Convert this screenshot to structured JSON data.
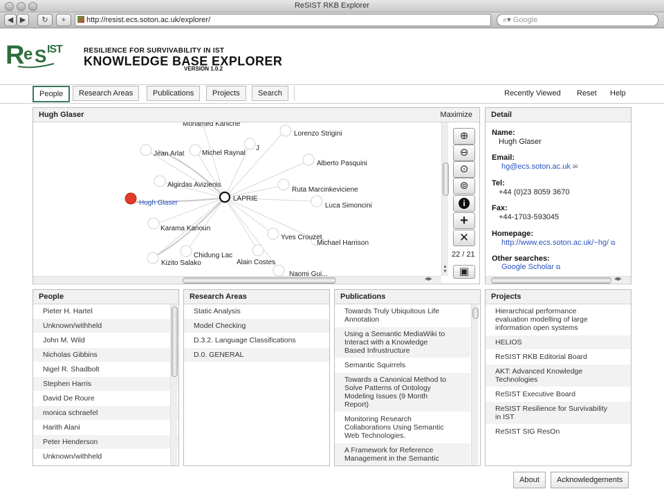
{
  "window": {
    "title": "ReSIST RKB Explorer"
  },
  "browser": {
    "url": "http://resist.ecs.soton.ac.uk/explorer/",
    "search_placeholder": "Google"
  },
  "header": {
    "logo": "ReSIST",
    "line1": "RESILIENCE FOR SURVIVABILITY IN IST",
    "line2": "KNOWLEDGE BASE EXPLORER",
    "version": "VERSION 1.0.2"
  },
  "nav": {
    "tabs": [
      "People",
      "Research Areas",
      "Publications",
      "Projects",
      "Search"
    ],
    "active": "People",
    "right": [
      "Recently Viewed",
      "Reset",
      "Help"
    ]
  },
  "graph": {
    "title": "Hugh Glaser",
    "maximize": "Maximize",
    "counter": "22 / 21",
    "center": "LAPRIE",
    "selected": "Hugh Glaser",
    "nodes": [
      "Mohamed Kaniche",
      "Lorenzo Strigini",
      "Jean Arlat",
      "Michel Raynal",
      "J",
      "Alberto Pasquini",
      "Algirdas Avizienis",
      "Ruta Marcinkeviciene",
      "Hugh Glaser",
      "Luca Simoncini",
      "Karama Kanoun",
      "Yves Crouzet",
      "Michael Harrison",
      "Chidung Lac",
      "Alain Costes",
      "Kizito Salako",
      "Naomi Gui..."
    ]
  },
  "detail": {
    "title": "Detail",
    "name_label": "Name:",
    "name": "Hugh Glaser",
    "email_label": "Email:",
    "email": "hg@ecs.soton.ac.uk",
    "tel_label": "Tel:",
    "tel": "+44 (0)23 8059 3670",
    "fax_label": "Fax:",
    "fax": "+44-1703-593045",
    "homepage_label": "Homepage:",
    "homepage": "http://www.ecs.soton.ac.uk/~hg/",
    "other_label": "Other searches:",
    "other": "Google Scholar"
  },
  "people": {
    "title": "People",
    "items": [
      "Pieter H. Hartel",
      "Unknown/withheld",
      "John M. Wild",
      "Nicholas Gibbins",
      "Nigel R. Shadbolt",
      "Stephen Harris",
      "David De Roure",
      "monica schraefel",
      "Harith Alani",
      "Peter Henderson",
      "Unknown/withheld"
    ]
  },
  "research": {
    "title": "Research Areas",
    "items": [
      "Static Analysis",
      "Model Checking",
      "D.3.2. Language Classifications",
      "D.0. GENERAL"
    ]
  },
  "publications": {
    "title": "Publications",
    "items": [
      [
        "Towards Truly Ubiquitous Life",
        "Annotation"
      ],
      [
        "Using a Semantic MediaWiki to",
        "Interact with a Knowledge",
        "Based Infrustructure"
      ],
      [
        "Semantic Squirrels"
      ],
      [
        "Towards a Canonical Method to",
        "Solve Patterns of Ontology",
        "Modeling Issues (9 Month",
        "Report)"
      ],
      [
        "Monitoring Research",
        "Collaborations Using Semantic",
        "Web Technologies."
      ],
      [
        "A Framework for Reference",
        "Management in the Semantic"
      ]
    ]
  },
  "projects": {
    "title": "Projects",
    "items": [
      [
        "Hierarchical performance",
        "evaluation modelling of large",
        "information open systems"
      ],
      [
        "HELIOS"
      ],
      [
        "ReSIST RKB Editorial Board"
      ],
      [
        "AKT: Advanced Knowledge",
        "Technologies"
      ],
      [
        "ReSIST Executive Board"
      ],
      [
        "ReSIST Resilience for Survivability",
        "in IST"
      ],
      [
        "ReSIST SIG ResOn"
      ]
    ]
  },
  "footer": {
    "about": "About",
    "ack": "Acknowledgements"
  },
  "colors": {
    "accent": "#37795a",
    "logo": "#2e6d3d",
    "selected_node": "#e23b2a",
    "link": "#2a52be"
  }
}
